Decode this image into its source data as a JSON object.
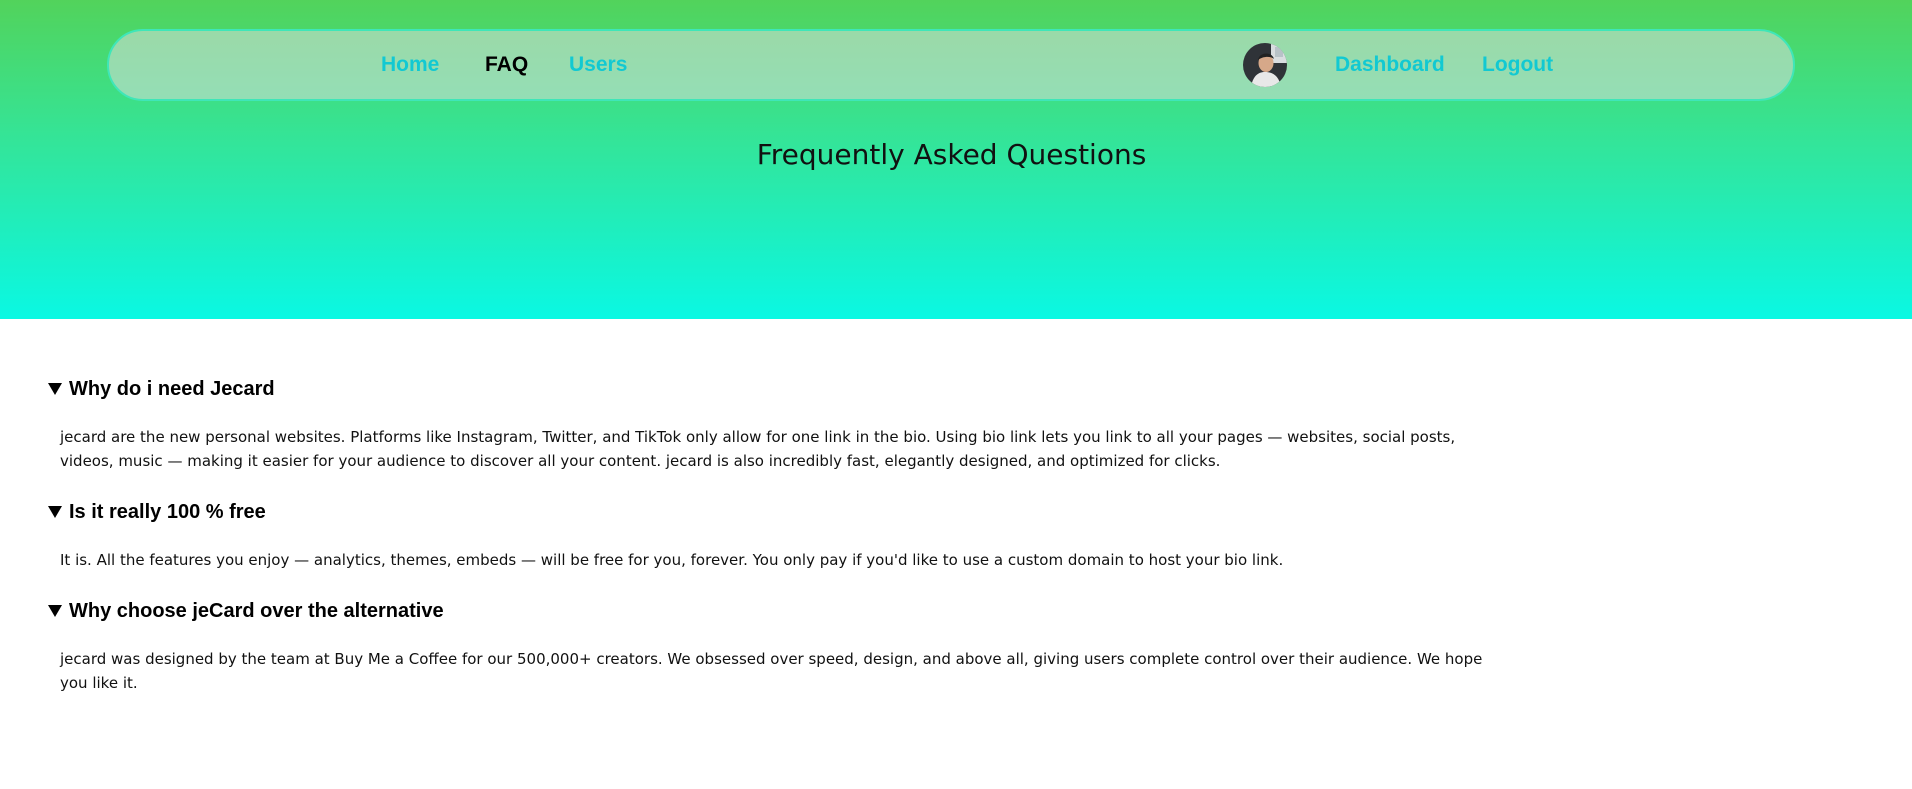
{
  "nav": {
    "links": [
      {
        "label": "Home"
      },
      {
        "label": "FAQ",
        "active": true
      },
      {
        "label": "Users"
      }
    ],
    "right_links": [
      {
        "label": "Dashboard"
      },
      {
        "label": "Logout"
      }
    ],
    "avatar_icon": "user-avatar",
    "link_color": "#12c9d2"
  },
  "page": {
    "title": "Frequently Asked Questions"
  },
  "faq": {
    "items": [
      {
        "question": "Why do i need Jecard",
        "answer": "jecard are the new personal websites. Platforms like Instagram, Twitter, and TikTok only allow for one link in the bio. Using bio link lets you link to all your pages — websites, social posts, videos, music — making it easier for your audience to discover all your content. jecard is also incredibly fast, elegantly designed, and optimized for clicks."
      },
      {
        "question": "Is it really 100 % free",
        "answer": "It is. All the features you enjoy — analytics, themes, embeds — will be free for you, forever. You only pay if you'd like to use a custom domain to host your bio link."
      },
      {
        "question": "Why choose jeCard over the alternative",
        "answer": "jecard was designed by the team at Buy Me a Coffee for our 500,000+ creators. We obsessed over speed, design, and above all, giving users complete control over their audience. We hope you like it."
      }
    ]
  },
  "colors": {
    "gradient_top": "#52d35b",
    "gradient_bottom": "#0af8e3"
  }
}
